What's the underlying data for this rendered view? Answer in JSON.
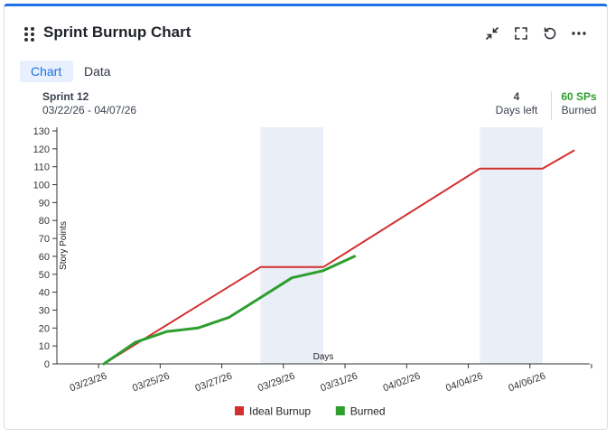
{
  "widget": {
    "title": "Sprint Burnup Chart",
    "tabs": [
      {
        "label": "Chart",
        "active": true
      },
      {
        "label": "Data",
        "active": false
      }
    ],
    "header_icons": [
      "collapse-icon",
      "fullscreen-icon",
      "refresh-icon",
      "more-icon"
    ]
  },
  "sprint": {
    "name": "Sprint 12",
    "dates": "03/22/26 - 04/07/26",
    "days_left_value": "4",
    "days_left_label": "Days left",
    "burned_value": "60 SPs",
    "burned_label": "Burned"
  },
  "colors": {
    "accent": "#1f6fe5",
    "ideal": "#d32f2f",
    "burned": "#2e9e2e",
    "weekend_band": "#e9eef7",
    "burned_stat": "#2e9e2e"
  },
  "chart_data": {
    "type": "line",
    "xlabel": "Days",
    "ylabel": "Story Points",
    "ylim": [
      0,
      130
    ],
    "yticks": [
      0,
      10,
      20,
      30,
      40,
      50,
      60,
      70,
      80,
      90,
      100,
      110,
      120,
      130
    ],
    "x_start": "03/22/26",
    "x_end": "04/07/26",
    "x_tick_labels": [
      "03/23/26",
      "03/25/26",
      "03/27/26",
      "03/29/26",
      "03/31/26",
      "04/02/26",
      "04/04/26",
      "04/06/26"
    ],
    "weekend_bands": [
      {
        "from": "03/28/26",
        "to": "03/30/26"
      },
      {
        "from": "04/04/26",
        "to": "04/06/26"
      }
    ],
    "series": [
      {
        "name": "Ideal Burnup",
        "color": "#d32f2f",
        "points": [
          {
            "x": "03/23/26",
            "y": 0
          },
          {
            "x": "03/28/26",
            "y": 54
          },
          {
            "x": "03/30/26",
            "y": 54
          },
          {
            "x": "04/04/26",
            "y": 109
          },
          {
            "x": "04/06/26",
            "y": 109
          },
          {
            "x": "04/07/26",
            "y": 119
          }
        ]
      },
      {
        "name": "Burned",
        "color": "#2e9e2e",
        "points": [
          {
            "x": "03/23/26",
            "y": 0
          },
          {
            "x": "03/24/26",
            "y": 12
          },
          {
            "x": "03/25/26",
            "y": 18
          },
          {
            "x": "03/26/26",
            "y": 20
          },
          {
            "x": "03/27/26",
            "y": 26
          },
          {
            "x": "03/28/26",
            "y": 37
          },
          {
            "x": "03/29/26",
            "y": 48
          },
          {
            "x": "03/30/26",
            "y": 52
          },
          {
            "x": "03/31/26",
            "y": 60
          }
        ]
      }
    ],
    "legend_position": "bottom",
    "grid": false
  }
}
